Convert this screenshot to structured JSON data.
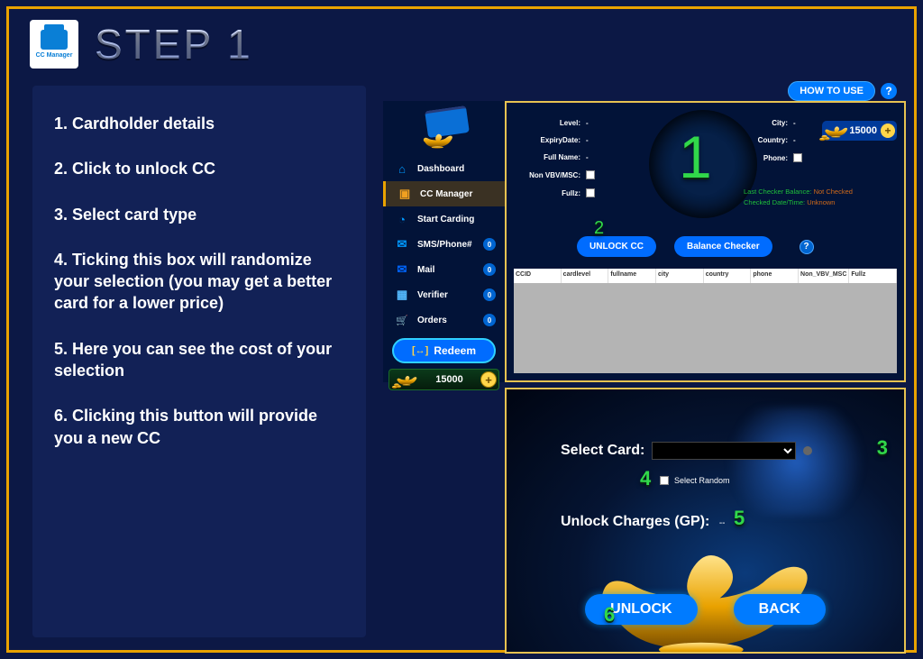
{
  "header": {
    "logo_label": "CC Manager",
    "title": "STEP 1"
  },
  "instructions": [
    "1. Cardholder details",
    "2. Click to unlock CC",
    "3. Select card type",
    "4. Ticking this box will randomize your selection (you may get a better card for a lower price)",
    "5. Here you can see the cost of your selection",
    "6. Clicking this button will provide you a new CC"
  ],
  "how_to_use": {
    "label": "HOW TO USE",
    "help": "?"
  },
  "sidebar": {
    "items": [
      {
        "label": "Dashboard"
      },
      {
        "label": "CC Manager"
      },
      {
        "label": "Start Carding"
      },
      {
        "label": "SMS/Phone#",
        "badge": "0"
      },
      {
        "label": "Mail",
        "badge": "0"
      },
      {
        "label": "Verifier",
        "badge": "0"
      },
      {
        "label": "Orders",
        "badge": "0"
      }
    ],
    "redeem": "Redeem",
    "balance": "15000"
  },
  "top_pane": {
    "balance": "15000",
    "left_fields": [
      "Level:",
      "ExpiryDate:",
      "Full Name:",
      "Non VBV/MSC:",
      "Fullz:"
    ],
    "right_fields": [
      "City:",
      "Country:",
      "Phone:"
    ],
    "status": {
      "l1a": "Last Checker Balance:",
      "l1b": "Not Checked",
      "l2a": "Checked Date/Time:",
      "l2b": "Unknown"
    },
    "unlock_btn": "UNLOCK CC",
    "balance_btn": "Balance Checker",
    "help": "?",
    "table_cols": [
      "CCID",
      "cardlevel",
      "fullname",
      "city",
      "country",
      "phone",
      "Non_VBV_MSC",
      "Fullz"
    ]
  },
  "markers": {
    "m1": "1",
    "m2": "2",
    "m3": "3",
    "m4": "4",
    "m5": "5",
    "m6": "6"
  },
  "bottom_pane": {
    "select_label": "Select Card:",
    "random_label": "Select Random",
    "charges_label": "Unlock Charges (GP):",
    "charges_value": "--",
    "unlock": "UNLOCK",
    "back": "BACK"
  }
}
